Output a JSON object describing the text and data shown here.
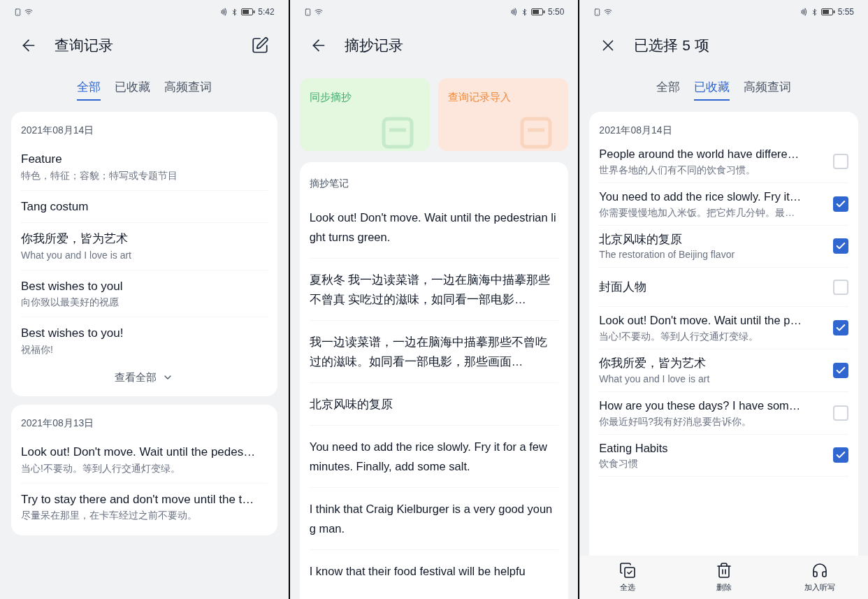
{
  "panels": [
    {
      "kind": "history",
      "status_bar": {
        "time": "5:42"
      },
      "header": {
        "title": "查询记录"
      },
      "tabs": [
        {
          "label": "全部",
          "selected": true
        },
        {
          "label": "已收藏",
          "selected": false
        },
        {
          "label": "高频查词",
          "selected": false
        }
      ],
      "groups": [
        {
          "date": "2021年08月14日",
          "more": "查看全部",
          "items": [
            {
              "title": "Feature",
              "subtitle": "特色，特征；容貌；特写或专题节目"
            },
            {
              "title": "Tang costum"
            },
            {
              "title": "你我所爱，皆为艺术",
              "subtitle": "What you and I love is art"
            },
            {
              "title": "Best wishes to youl",
              "subtitle": "向你致以最美好的祝愿"
            },
            {
              "title": "Best wishes to you!",
              "subtitle": "祝福你!"
            }
          ]
        },
        {
          "date": "2021年08月13日",
          "items": [
            {
              "title": "Look out! Don't move. Wait until the pedes…",
              "subtitle": "当心!不要动。等到人行交通灯变绿。"
            },
            {
              "title": "Try to stay there and don't move until the t…",
              "subtitle": "尽量呆在那里，在卡车经过之前不要动。"
            }
          ]
        }
      ]
    },
    {
      "kind": "notes",
      "status_bar": {
        "time": "5:50"
      },
      "header": {
        "title": "摘抄记录"
      },
      "actions": [
        {
          "label": "同步摘抄",
          "color": "#3fae6a"
        },
        {
          "label": "查询记录导入",
          "color": "#ee8a3a"
        }
      ],
      "section": "摘抄笔记",
      "notes": [
        "Look out! Don't move. Wait until the pedestrian light turns green.",
        "夏秋冬 我一边读菜谱，一边在脑海中描摹那些不曾真 实吃过的滋味，如同看一部电影…",
        "我一边读菜谱，一边在脑海中描摹那些不曾吃过的滋味。如同看一部电影，那些画面…",
        "北京风味的复原",
        "You need to add the rice slowly. Fry it for a few minutes. Finally, add some salt.",
        "I think that Craig Kielburger is a very good young man.",
        "I know that their food festival will be helpfu"
      ]
    },
    {
      "kind": "select",
      "status_bar": {
        "time": "5:55"
      },
      "header": {
        "title": "已选择 5 项"
      },
      "tabs": [
        {
          "label": "全部",
          "selected": false
        },
        {
          "label": "已收藏",
          "selected": true
        },
        {
          "label": "高频查词",
          "selected": false
        }
      ],
      "date": "2021年08月14日",
      "items": [
        {
          "title": "People around the world have differe…",
          "subtitle": "世界各地的人们有不同的饮食习惯。",
          "checked": false
        },
        {
          "title": "You need to add the rice slowly. Fry it…",
          "subtitle": "你需要慢慢地加入米饭。把它炸几分钟。最…",
          "checked": true
        },
        {
          "title": "北京风味的复原",
          "subtitle": "The restoration of Beijing flavor",
          "checked": true
        },
        {
          "title": "封面人物",
          "checked": false
        },
        {
          "title": "Look out! Don't move. Wait until the p…",
          "subtitle": "当心!不要动。等到人行交通灯变绿。",
          "checked": true
        },
        {
          "title": "你我所爱，皆为艺术",
          "subtitle": "What you and I love is art",
          "checked": true
        },
        {
          "title": "How are you these days? I have som…",
          "subtitle": "你最近好吗?我有好消息要告诉你。",
          "checked": false
        },
        {
          "title": "Eating Habits",
          "subtitle": "饮食习惯",
          "checked": true
        }
      ],
      "toolbar": [
        {
          "label": "全选"
        },
        {
          "label": "删除"
        },
        {
          "label": "加入听写"
        }
      ]
    }
  ]
}
